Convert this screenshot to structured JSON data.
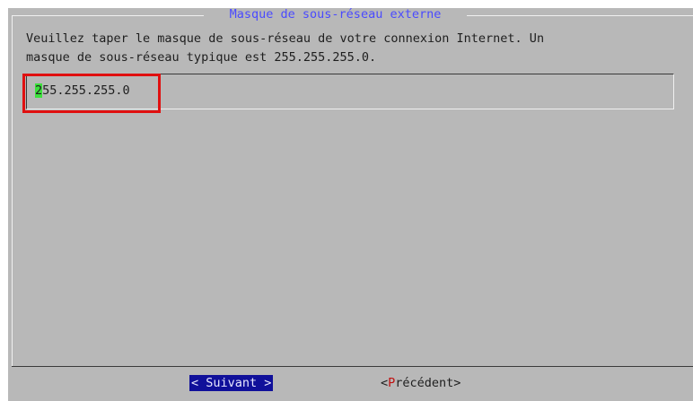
{
  "dialog": {
    "title": "Masque de sous-réseau externe",
    "prompt_line1": "Veuillez taper le masque de sous-réseau de votre connexion Internet. Un",
    "prompt_line2": "masque de sous-réseau typique est 255.255.255.0."
  },
  "input": {
    "first_char": "2",
    "rest": "55.255.255.0"
  },
  "buttons": {
    "next_label": "< Suivant >",
    "prev_open": "<",
    "prev_hotkey": "P",
    "prev_rest": "récédent>"
  },
  "colors": {
    "dialog_background": "#b8b8b8",
    "title": "#4a4aff",
    "cursor": "#3ce03c",
    "highlight": "#e01010",
    "selected_button": "#10109a",
    "hotkey": "#c01010"
  }
}
